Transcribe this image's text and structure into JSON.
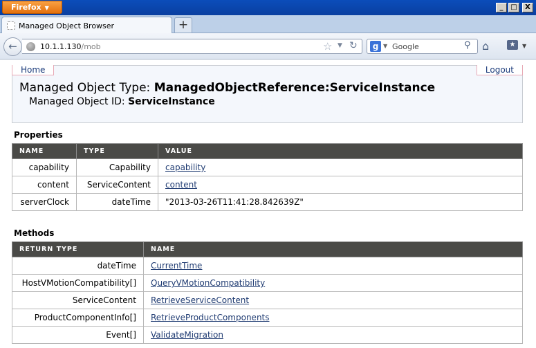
{
  "browser": {
    "app_button": "Firefox",
    "window_buttons": [
      "_",
      "□",
      "X"
    ],
    "tab_title": "Managed Object Browser",
    "new_tab": "+",
    "url_host": "10.1.1.130",
    "url_path": "/mob",
    "search_placeholder": "Google",
    "search_logo": "g"
  },
  "page": {
    "home_link": "Home",
    "logout_link": "Logout",
    "type_label": "Managed Object Type:",
    "type_value": "ManagedObjectReference:ServiceInstance",
    "id_label": "Managed Object ID:",
    "id_value": "ServiceInstance",
    "properties": {
      "title": "Properties",
      "headers": [
        "NAME",
        "TYPE",
        "VALUE"
      ],
      "rows": [
        {
          "name": "capability",
          "type": "Capability",
          "value": "capability",
          "link": true
        },
        {
          "name": "content",
          "type": "ServiceContent",
          "value": "content",
          "link": true
        },
        {
          "name": "serverClock",
          "type": "dateTime",
          "value": "\"2013-03-26T11:41:28.842639Z\"",
          "link": false
        }
      ]
    },
    "methods": {
      "title": "Methods",
      "headers": [
        "RETURN TYPE",
        "NAME"
      ],
      "rows": [
        {
          "return_type": "dateTime",
          "name": "CurrentTime"
        },
        {
          "return_type": "HostVMotionCompatibility[]",
          "name": "QueryVMotionCompatibility"
        },
        {
          "return_type": "ServiceContent",
          "name": "RetrieveServiceContent"
        },
        {
          "return_type": "ProductComponentInfo[]",
          "name": "RetrieveProductComponents"
        },
        {
          "return_type": "Event[]",
          "name": "ValidateMigration"
        }
      ]
    }
  },
  "icons": [
    "back-icon",
    "globe-icon",
    "star-icon",
    "reload-icon",
    "search-icon",
    "home-icon",
    "bookmarks-icon"
  ]
}
